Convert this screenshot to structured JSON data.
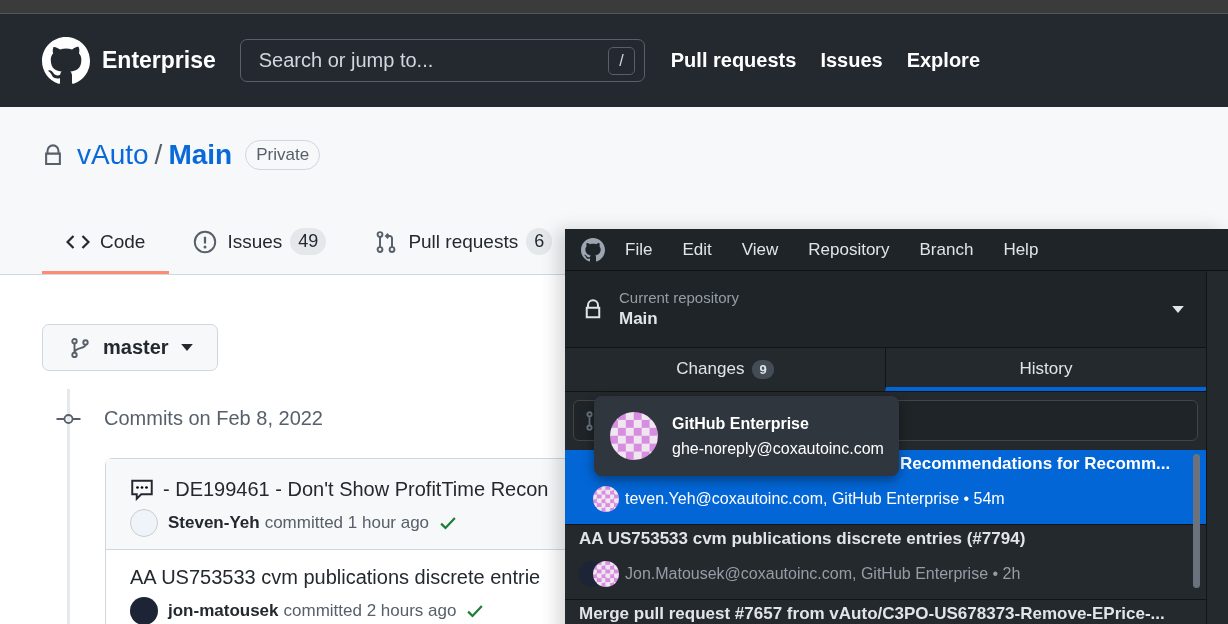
{
  "header": {
    "brand": "Enterprise",
    "search": {
      "placeholder": "Search or jump to...",
      "shortcut": "/"
    },
    "nav": [
      "Pull requests",
      "Issues",
      "Explore"
    ]
  },
  "repo": {
    "owner": "vAuto",
    "separator": "/",
    "name": "Main",
    "visibility": "Private"
  },
  "repo_tabs": [
    {
      "label": "Code",
      "selected": true
    },
    {
      "label": "Issues",
      "count": "49",
      "selected": false
    },
    {
      "label": "Pull requests",
      "count": "6",
      "selected": false
    }
  ],
  "branch": "master",
  "commits_heading": "Commits on Feb 8, 2022",
  "commits": [
    {
      "title": "- DE199461 - Don't Show ProfitTime Recon",
      "discussion": true,
      "author": "Steven-Yeh",
      "action": "committed",
      "time": "1 hour ago"
    },
    {
      "title": "AA US753533 cvm publications discrete entrie",
      "discussion": false,
      "author": "jon-matousek",
      "action": "committed",
      "time": "2 hours ago"
    }
  ],
  "desktop": {
    "menu": [
      "File",
      "Edit",
      "View",
      "Repository",
      "Branch",
      "Help"
    ],
    "repository": {
      "label": "Current repository",
      "name": "Main"
    },
    "tabs": [
      {
        "label": "Changes",
        "count": "9",
        "selected": false
      },
      {
        "label": "History",
        "selected": true
      }
    ],
    "commits": [
      {
        "title": "Recommendations for Recomm...",
        "meta": "teven.Yeh@coxautoinc.com, GitHub Enterprise • 54m",
        "selected": true
      },
      {
        "title": "AA US753533 cvm publications discrete entries (#7794)",
        "meta": "Jon.Matousek@coxautoinc.com, GitHub Enterprise • 2h",
        "selected": false
      },
      {
        "title": "Merge pull request #7657 from vAuto/C3PO-US678373-Remove-EPrice-...",
        "selected": false
      }
    ],
    "tooltip": {
      "name": "GitHub Enterprise",
      "email": "ghe-noreply@coxautoinc.com"
    }
  }
}
